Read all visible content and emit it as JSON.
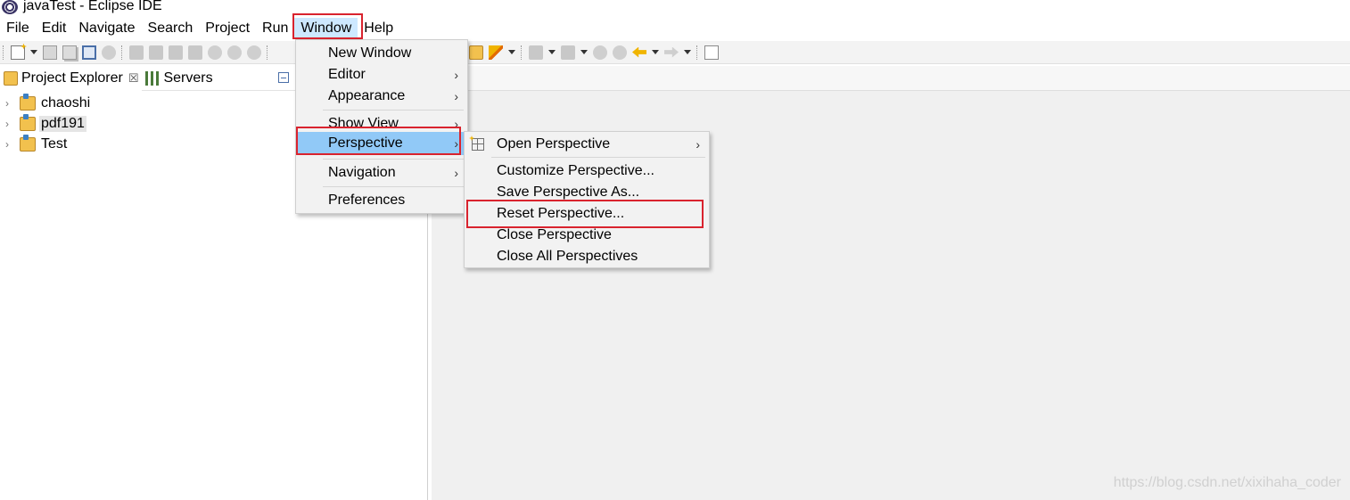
{
  "window": {
    "title": "javaTest - Eclipse IDE",
    "app_icon": "eclipse-icon"
  },
  "menubar": {
    "items": [
      "File",
      "Edit",
      "Navigate",
      "Search",
      "Project",
      "Run",
      "Window",
      "Help"
    ],
    "active": "Window"
  },
  "explorer": {
    "tabs": [
      {
        "label": "Project Explorer",
        "icon": "project-explorer-icon",
        "close": "☒"
      },
      {
        "label": "Servers",
        "icon": "servers-icon"
      }
    ],
    "projects": [
      {
        "name": "chaoshi",
        "selected": false
      },
      {
        "name": "pdf191",
        "selected": true
      },
      {
        "name": "Test",
        "selected": false
      }
    ],
    "chevron": "›"
  },
  "window_menu": {
    "items": [
      {
        "label": "New Window",
        "submenu": false
      },
      {
        "label": "Editor",
        "submenu": true
      },
      {
        "label": "Appearance",
        "submenu": true
      },
      {
        "label": "Show View",
        "submenu": true
      },
      {
        "label": "Perspective",
        "submenu": true,
        "highlighted": true
      },
      {
        "label": "Navigation",
        "submenu": true
      },
      {
        "label": "Preferences",
        "submenu": false
      }
    ],
    "arrow": "›"
  },
  "perspective_menu": {
    "items": [
      {
        "label": "Open Perspective",
        "submenu": true,
        "icon": "open-perspective-icon"
      },
      {
        "label": "Customize Perspective..."
      },
      {
        "label": "Save Perspective As..."
      },
      {
        "label": "Reset Perspective..."
      },
      {
        "label": "Close Perspective"
      },
      {
        "label": "Close All Perspectives"
      }
    ],
    "arrow": "›"
  },
  "watermark": "https://blog.csdn.net/xixihaha_coder",
  "colors": {
    "highlight": "#91c9f7",
    "active_menu": "#cde8ff",
    "annotation_red": "#d9232e"
  }
}
